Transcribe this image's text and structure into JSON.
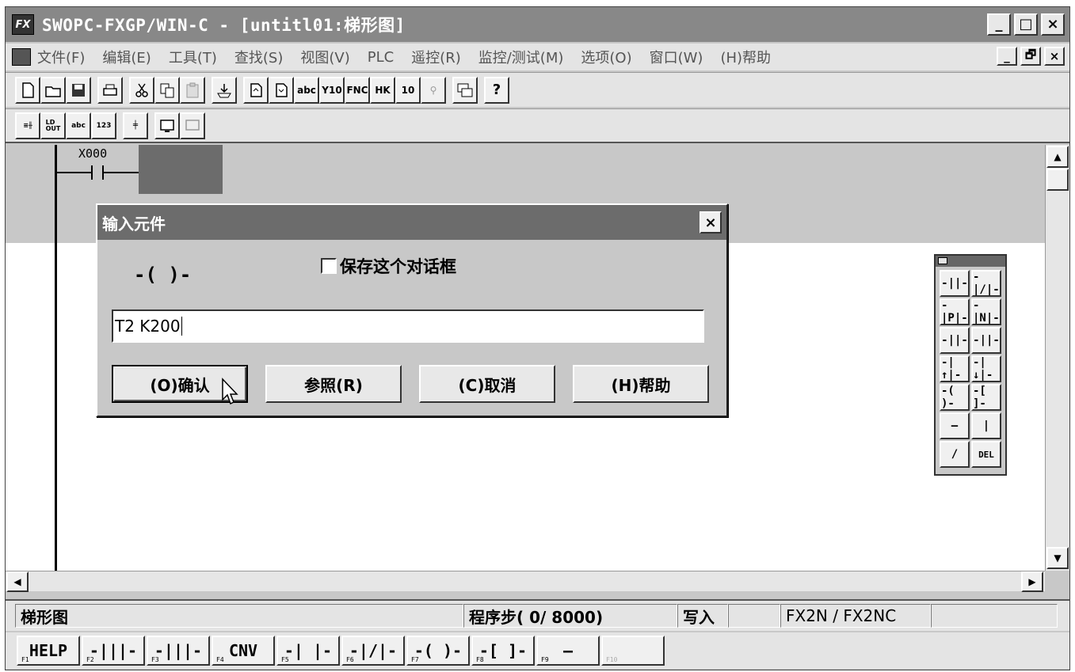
{
  "window": {
    "title": "SWOPC-FXGP/WIN-C - [untitl01:梯形图]",
    "app_icon": "FX",
    "minimize": "_",
    "maximize": "□",
    "close": "×"
  },
  "menu": {
    "items": [
      "文件(F)",
      "编辑(E)",
      "工具(T)",
      "查找(S)",
      "视图(V)",
      "PLC",
      "遥控(R)",
      "监控/测试(M)",
      "选项(O)",
      "窗口(W)",
      "(H)帮助"
    ],
    "mdi_min": "_",
    "mdi_restore": "🗗",
    "mdi_close": "×"
  },
  "ladder": {
    "contact_label": "X000"
  },
  "dialog": {
    "title": "输入元件",
    "close": "×",
    "coil_symbol": "-( )-",
    "save_label": "保存这个对话框",
    "input_value": "T2 K200",
    "ok": "(O)确认",
    "ref": "参照(R)",
    "cancel": "(C)取消",
    "help": "(H)帮助"
  },
  "palette": {
    "buttons": [
      "-||-",
      "-|/|-",
      "-|P|-",
      "-|N|-",
      "-||-",
      "-||-",
      "-|↑|-",
      "-|↓|-",
      "-( )-",
      "-[ ]-",
      "—",
      "|",
      "/",
      "DEL"
    ]
  },
  "status": {
    "mode": "梯形图",
    "steps": "程序步(    0/ 8000)",
    "write": "写入",
    "model": "FX2N / FX2NC"
  },
  "fkeys": [
    {
      "num": "F1",
      "label": "HELP"
    },
    {
      "num": "F2",
      "label": "-|||-"
    },
    {
      "num": "F3",
      "label": "-|||-"
    },
    {
      "num": "F4",
      "label": "CNV"
    },
    {
      "num": "F5",
      "label": "-| |-"
    },
    {
      "num": "F6",
      "label": "-|/|-"
    },
    {
      "num": "F7",
      "label": "-( )-"
    },
    {
      "num": "F8",
      "label": "-[ ]-"
    },
    {
      "num": "F9",
      "label": "—"
    },
    {
      "num": "F10",
      "label": ""
    }
  ]
}
